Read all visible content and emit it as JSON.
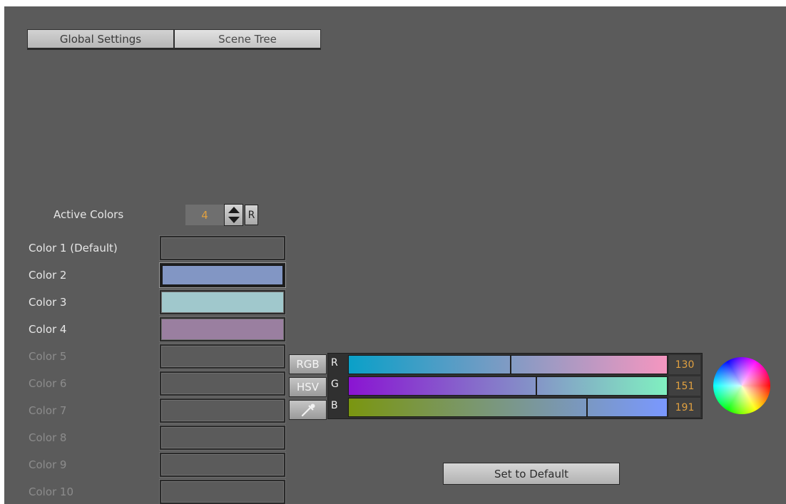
{
  "tabs": {
    "global_settings": "Global Settings",
    "scene_tree": "Scene Tree"
  },
  "active_colors": {
    "label": "Active Colors",
    "value": "4",
    "reset_label": "R"
  },
  "colors": [
    {
      "label": "Color 1 (Default)",
      "swatch": "transparent",
      "enabled": true
    },
    {
      "label": "Color 2",
      "swatch": "#8296c4",
      "enabled": true,
      "selected": true
    },
    {
      "label": "Color 3",
      "swatch": "#a0c8cc",
      "enabled": true
    },
    {
      "label": "Color 4",
      "swatch": "#9a7fa0",
      "enabled": true
    },
    {
      "label": "Color 5",
      "swatch": "transparent",
      "enabled": false
    },
    {
      "label": "Color 6",
      "swatch": "transparent",
      "enabled": false
    },
    {
      "label": "Color 7",
      "swatch": "transparent",
      "enabled": false
    },
    {
      "label": "Color 8",
      "swatch": "transparent",
      "enabled": false
    },
    {
      "label": "Color 9",
      "swatch": "transparent",
      "enabled": false
    },
    {
      "label": "Color 10",
      "swatch": "transparent",
      "enabled": false
    }
  ],
  "mode_buttons": {
    "rgb": "RGB",
    "hsv": "HSV",
    "picker_icon": "eyedropper-icon"
  },
  "channels": {
    "r": {
      "label": "R",
      "value": "130",
      "level": 0.51,
      "gradient": [
        "#0aa0c8",
        "#f596c0"
      ]
    },
    "g": {
      "label": "G",
      "value": "151",
      "level": 0.59,
      "gradient": [
        "#8a14d2",
        "#80f0c0"
      ]
    },
    "b": {
      "label": "B",
      "value": "191",
      "level": 0.75,
      "gradient": [
        "#7a9610",
        "#7a98ff"
      ]
    }
  },
  "wheel_icon": "color-wheel-icon",
  "set_default_label": "Set to Default"
}
